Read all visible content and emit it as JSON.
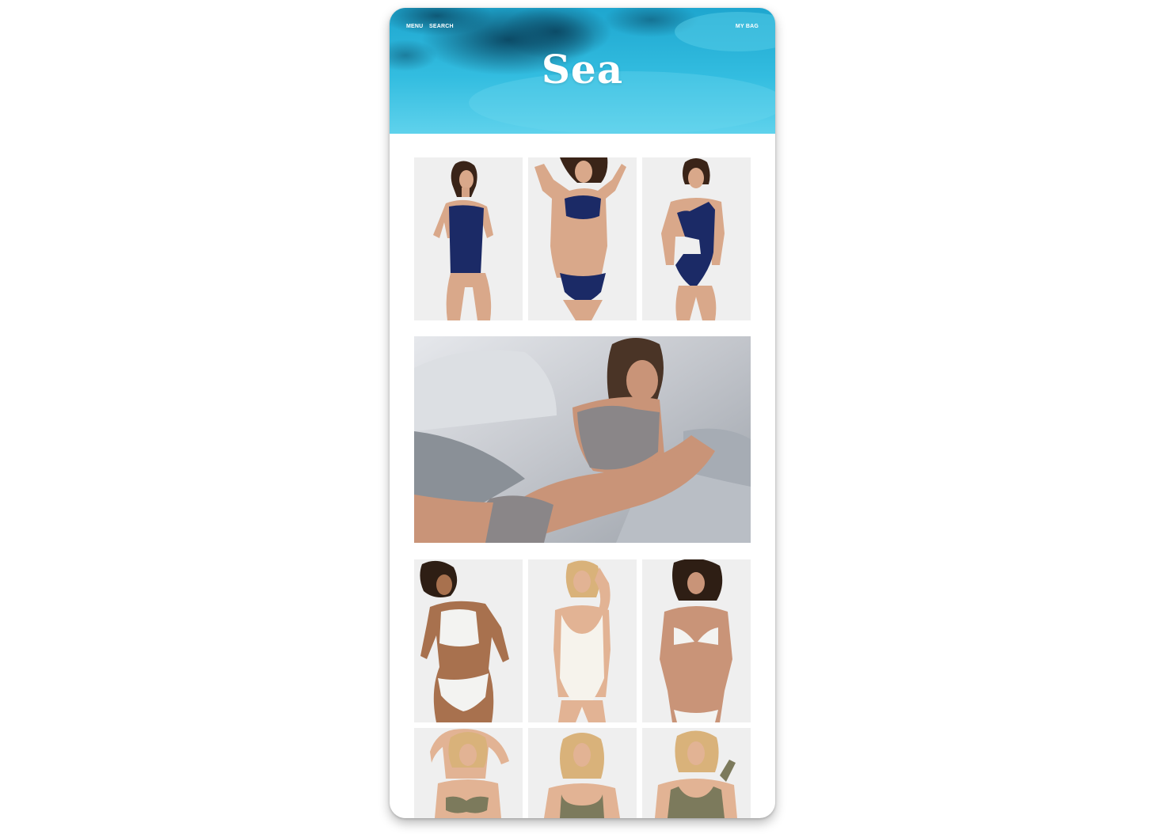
{
  "header": {
    "menu_label": "MENU",
    "search_label": "SEARCH",
    "bag_label": "MY BAG",
    "title": "Sea"
  },
  "colors": {
    "sea_light": "#41c4e4",
    "sea_deep": "#0d5a7e",
    "navy_swimwear": "#1b2a66",
    "grey_swimwear": "#8a8688",
    "white_swimwear": "#f3f3f1",
    "olive_swimwear": "#7c7a5c",
    "tile_background": "#efefef",
    "rock": "#c9cbd0"
  },
  "products": [
    {
      "row": 1,
      "swimwear": "navy one-piece, square neck"
    },
    {
      "row": 1,
      "swimwear": "navy bikini"
    },
    {
      "row": 1,
      "swimwear": "navy one-shoulder cut-out one-piece"
    },
    {
      "row": 3,
      "swimwear": "white crop top and high-cut bottom"
    },
    {
      "row": 3,
      "swimwear": "white scoop-neck one-piece"
    },
    {
      "row": 3,
      "swimwear": "white triangle bikini"
    },
    {
      "row": 4,
      "swimwear": "olive bikini top"
    },
    {
      "row": 4,
      "swimwear": "olive scoop top"
    },
    {
      "row": 4,
      "swimwear": "olive tank top"
    }
  ]
}
